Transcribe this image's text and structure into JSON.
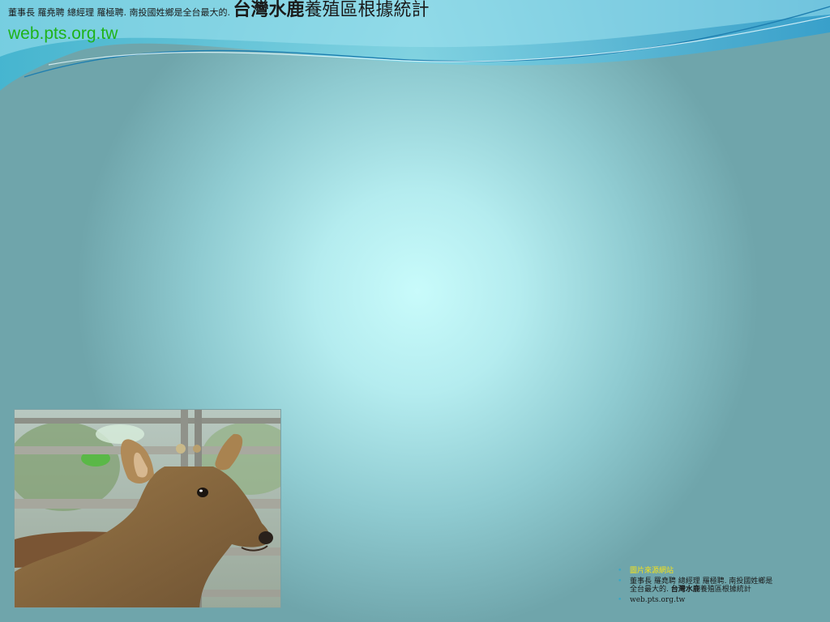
{
  "header": {
    "caption_prefix": "董事長 羅堯聘 總經理 羅極聘. 南投國姓鄉是全台最大的.",
    "caption_bold": "台灣水鹿",
    "caption_rest": "養殖區根據統計",
    "source_site": "web.pts.org.tw"
  },
  "photo": {
    "icon": "deer-photo"
  },
  "notes": {
    "items": [
      {
        "type": "link",
        "text": "圖片來源網站"
      },
      {
        "type": "caption",
        "prefix": "董事長 羅堯聘 總經理 羅極聘. 南投國姓鄉是全台最大的.",
        "bold": "台灣水鹿",
        "rest": "養殖區根據統計"
      },
      {
        "type": "site",
        "text": "web.pts.org.tw"
      }
    ]
  },
  "colors": {
    "link_green": "#1fb31a",
    "link_yellow": "#f4e21a",
    "wave_blue": "#2fa8d6",
    "bullet": "#3aa6c6"
  }
}
